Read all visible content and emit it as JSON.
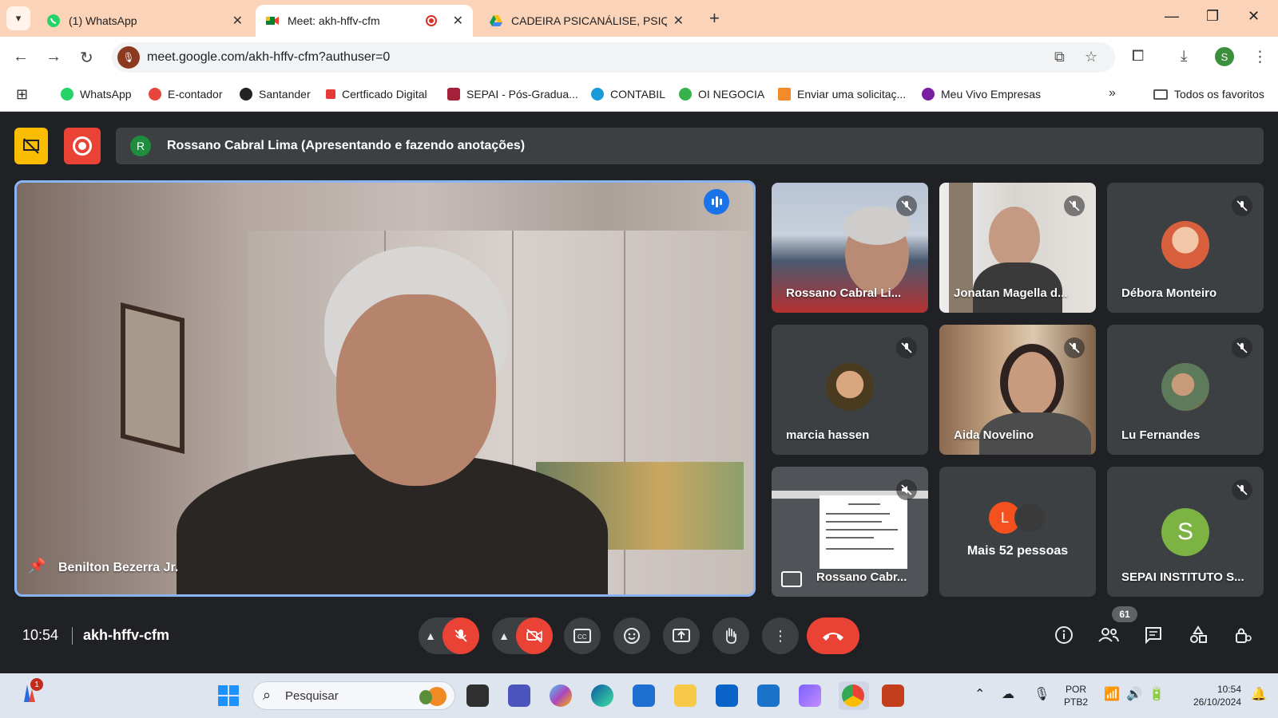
{
  "browser": {
    "tabs": [
      {
        "label": "(1) WhatsApp",
        "color": "#25d366"
      },
      {
        "label": "Meet: akh-hffv-cfm",
        "color": "#00832d"
      },
      {
        "label": "CADEIRA PSICANÁLISE, PSIQUIA",
        "color": "#fbbc04"
      }
    ],
    "url": "meet.google.com/akh-hffv-cfm?authuser=0",
    "profile_initial": "S"
  },
  "bookmarks": {
    "items": [
      {
        "label": "WhatsApp",
        "color": "#25d366"
      },
      {
        "label": "E-contador",
        "color": "#e8453c"
      },
      {
        "label": "Santander",
        "color": "#222222"
      },
      {
        "label": "Certficado Digital",
        "color": "#e53935"
      },
      {
        "label": "SEPAI - Pós-Gradua...",
        "color": "#a4213a"
      },
      {
        "label": "CONTABIL",
        "color": "#1a9bd7"
      },
      {
        "label": "OI NEGOCIA",
        "color": "#35b34a"
      },
      {
        "label": "Enviar uma solicitaç...",
        "color": "#f28c28"
      },
      {
        "label": "Meu Vivo Empresas",
        "color": "#7b1fa2"
      }
    ],
    "all_label": "Todos os favoritos"
  },
  "meet": {
    "presenter_initial": "R",
    "presenter_banner": "Rossano Cabral Lima (Apresentando e fazendo anotações)",
    "main_speaker": "Benilton Bezerra Jr.",
    "participants": [
      {
        "name": "Rossano Cabral Li...",
        "muted": true
      },
      {
        "name": "Jonatan Magella d...",
        "muted": true
      },
      {
        "name": "Débora Monteiro",
        "muted": true
      },
      {
        "name": "marcia hassen",
        "muted": true
      },
      {
        "name": "Aida Novelino",
        "muted": true
      },
      {
        "name": "Lu Fernandes",
        "muted": true
      },
      {
        "name": "Rossano Cabr...",
        "muted": true
      },
      {
        "name": "Mais 52 pessoas",
        "muted": false
      },
      {
        "name": "SEPAI INSTITUTO S...",
        "muted": true
      }
    ],
    "more_people_initial": "L",
    "sepai_initial": "S",
    "time": "10:54",
    "meeting_code": "akh-hffv-cfm",
    "people_count": "61"
  },
  "taskbar": {
    "notification_count": "1",
    "search_placeholder": "Pesquisar",
    "lang_line1": "POR",
    "lang_line2": "PTB2",
    "time": "10:54",
    "date": "26/10/2024"
  }
}
